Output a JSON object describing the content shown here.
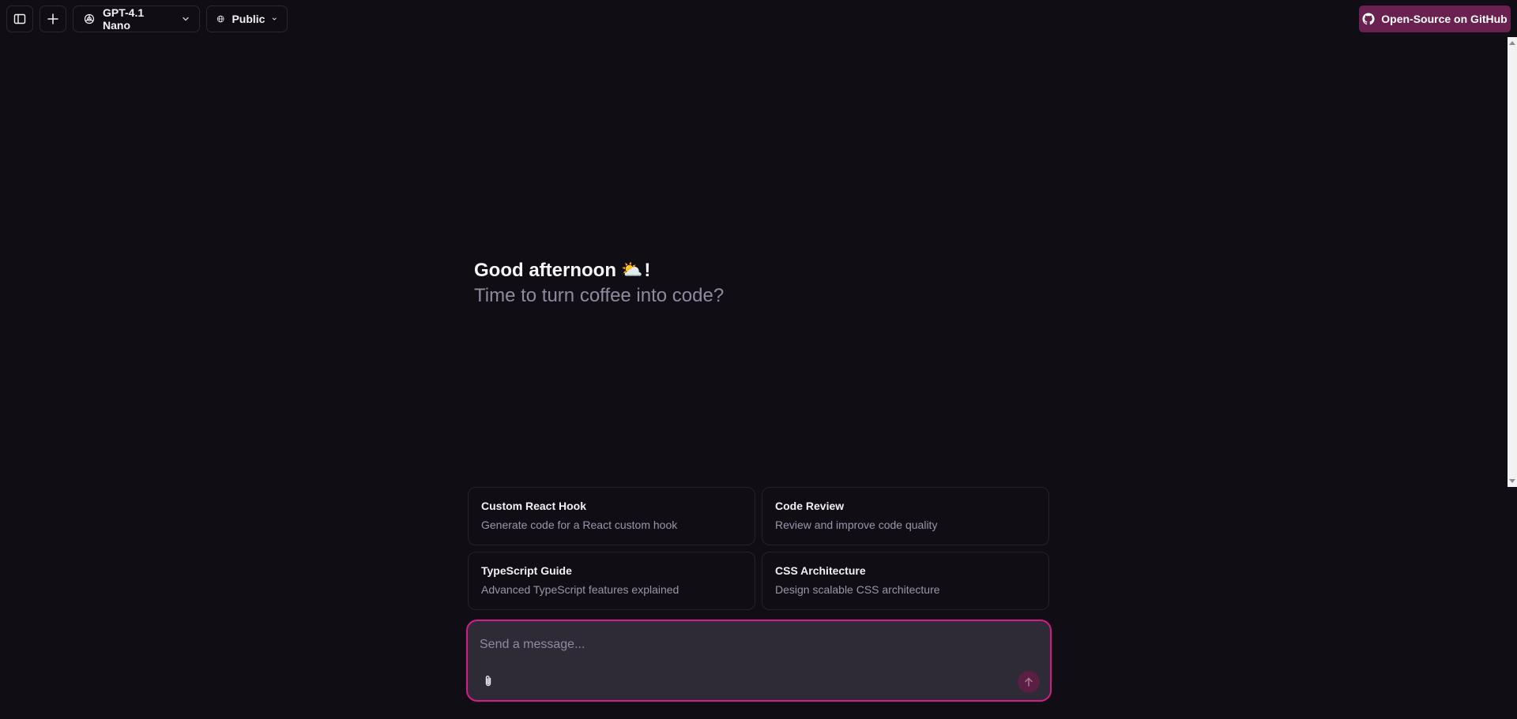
{
  "header": {
    "model_label": "GPT-4.1 Nano",
    "visibility_label": "Public",
    "github_label": "Open-Source on GitHub"
  },
  "greeting": {
    "title": "Good afternoon",
    "emoji": "⛅",
    "exclaim": "!",
    "subtitle": "Time to turn coffee into code?"
  },
  "suggestions": [
    {
      "title": "Custom React Hook",
      "description": "Generate code for a React custom hook"
    },
    {
      "title": "Code Review",
      "description": "Review and improve code quality"
    },
    {
      "title": "TypeScript Guide",
      "description": "Advanced TypeScript features explained"
    },
    {
      "title": "CSS Architecture",
      "description": "Design scalable CSS architecture"
    }
  ],
  "composer": {
    "placeholder": "Send a message...",
    "value": ""
  },
  "colors": {
    "background": "#100e14",
    "accent": "#d81b8c",
    "github_bg": "#6b2150"
  },
  "icons": {
    "sidebar_toggle": "sidebar-icon",
    "new_chat": "plus-icon",
    "model": "openai-icon",
    "visibility": "globe-icon",
    "github": "github-icon",
    "attach": "paperclip-icon",
    "send": "arrow-up-icon"
  }
}
